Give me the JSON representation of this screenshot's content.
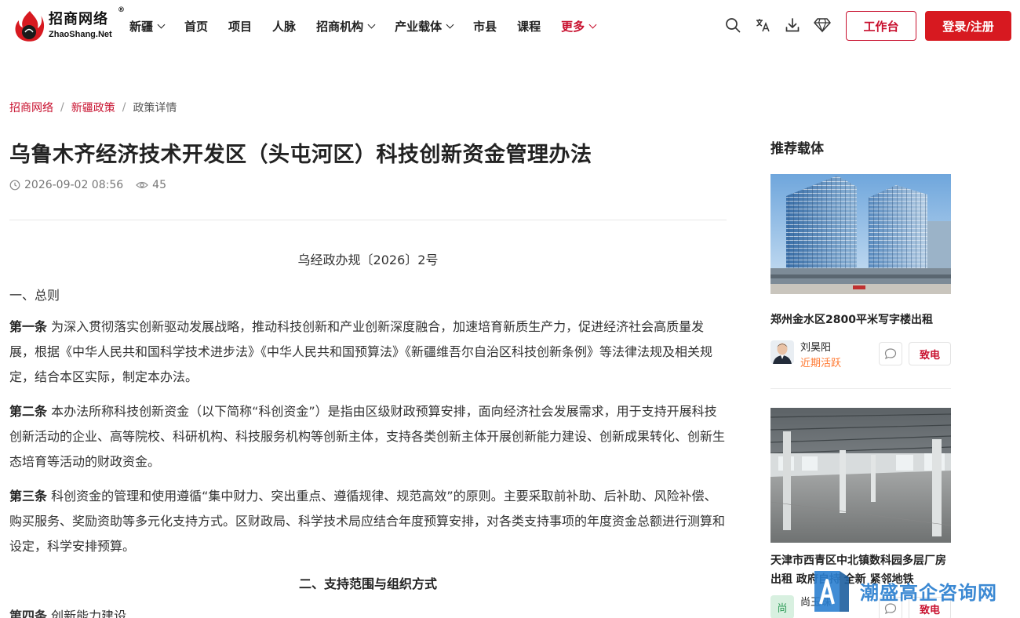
{
  "header": {
    "logo": {
      "cn": "招商网络",
      "reg": "®",
      "en": "ZhaoShang.Net"
    },
    "nav": [
      {
        "label": "新疆",
        "dropdown": true
      },
      {
        "label": "首页",
        "dropdown": false
      },
      {
        "label": "项目",
        "dropdown": false
      },
      {
        "label": "人脉",
        "dropdown": false
      },
      {
        "label": "招商机构",
        "dropdown": true
      },
      {
        "label": "产业载体",
        "dropdown": true
      },
      {
        "label": "市县",
        "dropdown": false
      },
      {
        "label": "课程",
        "dropdown": false
      },
      {
        "label": "更多",
        "dropdown": true
      }
    ],
    "icons": [
      "search-icon",
      "translate-icon",
      "download-icon",
      "diamond-icon"
    ],
    "workbench_label": "工作台",
    "login_label": "登录/注册",
    "accent": "#c8102e"
  },
  "breadcrumb": {
    "items": [
      "招商网络",
      "新疆政策"
    ],
    "current": "政策详情",
    "separator": "/"
  },
  "article": {
    "title": "乌鲁木齐经济技术开发区（头屯河区）科技创新资金管理办法",
    "date": "2026-09-02 08:56",
    "views": "45",
    "doc_no": "乌经政办规〔2026〕2号",
    "section1": "一、总则",
    "p1_label": "第一条",
    "p1_text": " 为深入贯彻落实创新驱动发展战略，推动科技创新和产业创新深度融合，加速培育新质生产力，促进经济社会高质量发展，根据《中华人民共和国科学技术进步法》《中华人民共和国预算法》《新疆维吾尔自治区科技创新条例》等法律法规及相关规定，结合本区实际，制定本办法。",
    "p2_label": "第二条",
    "p2_text": " 本办法所称科技创新资金（以下简称“科创资金”）是指由区级财政预算安排，面向经济社会发展需求，用于支持开展科技创新活动的企业、高等院校、科研机构、科技服务机构等创新主体，支持各类创新主体开展创新能力建设、创新成果转化、创新生态培育等活动的财政资金。",
    "p3_label": "第三条",
    "p3_text": " 科创资金的管理和使用遵循“集中财力、突出重点、遵循规律、规范高效”的原则。主要采取前补助、后补助、风险补偿、购买服务、奖励资助等多元化支持方式。区财政局、科学技术局应结合年度预算安排，对各类支持事项的年度资金总额进行测算和设定，科学安排预算。",
    "section2": "二、支持范围与组织方式",
    "p4_label": "第四条",
    "p4_text": " 创新能力建设"
  },
  "sidebar": {
    "title": "推荐载体",
    "cards": [
      {
        "name": "郑州金水区2800平米写字楼出租",
        "agent_name": "刘昊阳",
        "agent_status": "近期活跃",
        "call_label": "致电"
      },
      {
        "name": "天津市西青区中北镇数科园多层厂房出租 政府自持 全新 紧邻地铁",
        "agent_avatar_text": "尚",
        "agent_name": "尚玉珠",
        "call_label": "致电"
      }
    ]
  },
  "watermark": {
    "text": "潮盛高企咨询网"
  }
}
